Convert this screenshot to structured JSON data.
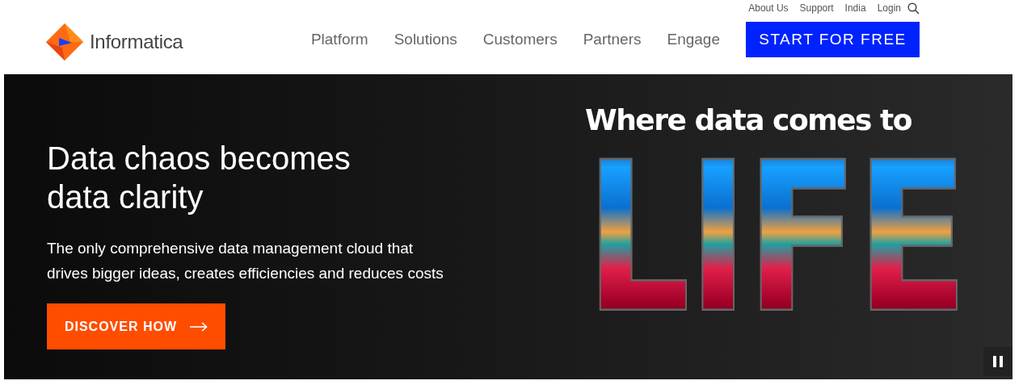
{
  "utility_links": [
    {
      "label": "About Us"
    },
    {
      "label": "Support"
    },
    {
      "label": "India"
    },
    {
      "label": "Login"
    }
  ],
  "logo": {
    "text": "Informatica"
  },
  "nav": [
    {
      "label": "Platform"
    },
    {
      "label": "Solutions"
    },
    {
      "label": "Customers"
    },
    {
      "label": "Partners"
    },
    {
      "label": "Engage"
    }
  ],
  "cta": {
    "label": "START FOR FREE"
  },
  "hero": {
    "heading": "Data chaos becomes data clarity",
    "text": "The only comprehensive data management cloud that drives bigger ideas, creates efficiencies and reduces costs",
    "button": "DISCOVER HOW",
    "art_tagline": "Where data comes to",
    "art_word": "LIFE"
  }
}
